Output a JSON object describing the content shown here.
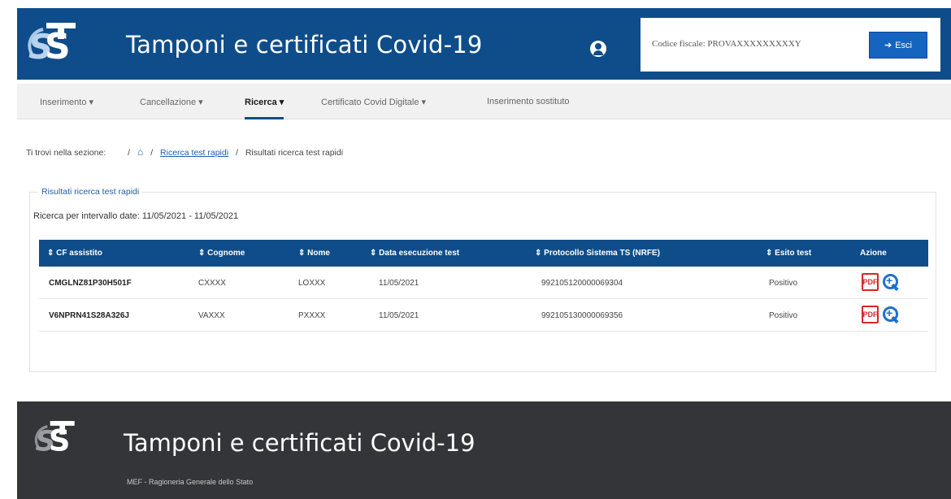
{
  "header": {
    "logo_text": "STS",
    "title": "Tamponi e certificati Covid-19",
    "user_icon": "user-icon",
    "codice_fiscale": "Codice fiscale: PROVAXXXXXXXXXY",
    "exit_label": "Esci",
    "colors": {
      "bar": "#0e4d8a",
      "exit_button": "#1565c0"
    }
  },
  "nav": {
    "items": [
      {
        "label": "Inserimento ▾"
      },
      {
        "label": "Cancellazione ▾"
      },
      {
        "label": "Ricerca ▾"
      },
      {
        "label": "Certificato Covid Digitale ▾"
      },
      {
        "label": "Inserimento sostituto"
      }
    ],
    "active_index": 2
  },
  "breadcrumb": {
    "prefix": "Ti trovi nella sezione:",
    "home_icon": "home-icon",
    "link": "Ricerca test rapidi",
    "current": "Risultati ricerca test rapidi"
  },
  "results": {
    "legend": "Risultati ricerca test rapidi",
    "search_info": "Ricerca per intervallo date: 11/05/2021 - 11/05/2021",
    "columns": [
      "⇕ CF assistito",
      "⇕ Cognome",
      "⇕ Nome",
      "⇕ Data esecuzione test",
      "⇕ Protocollo Sistema TS (NRFE)",
      "⇕ Esito test",
      "Azione"
    ],
    "rows": [
      {
        "cf": "CMGLNZ81P30H501F",
        "cognome": "CXXXX",
        "nome": "LOXXX",
        "data": "11/05/2021",
        "protocollo": "992105120000069304",
        "esito": "Positivo"
      },
      {
        "cf": "V6NPRN41S28A326J",
        "cognome": "VAXXX",
        "nome": "PXXXX",
        "data": "11/05/2021",
        "protocollo": "992105130000069356",
        "esito": "Positivo"
      }
    ],
    "action_icons": [
      "pdf-icon",
      "zoom-in-icon"
    ]
  },
  "footer": {
    "logo_text": "STS",
    "title": "Tamponi e certificati Covid-19",
    "subtitle": "MEF - Ragioneria Generale dello Stato"
  }
}
